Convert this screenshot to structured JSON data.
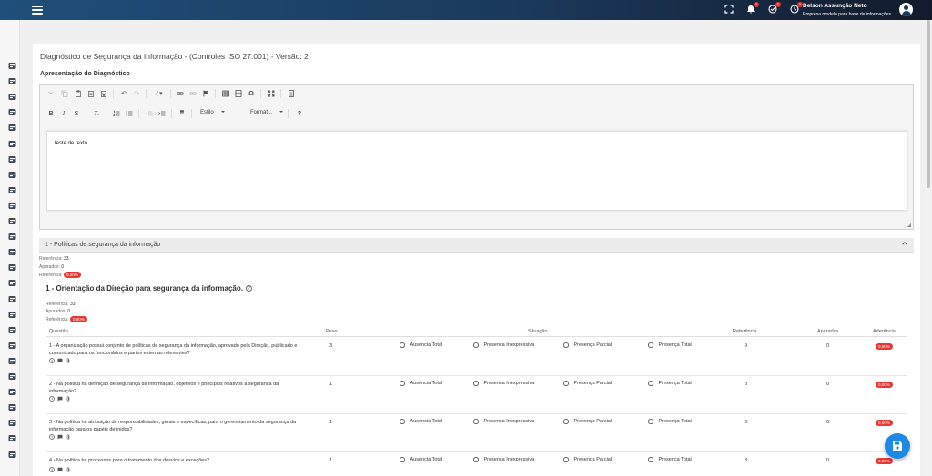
{
  "header": {
    "user_name": "Delson Assunção Neto",
    "company": "Empresa modelo para base de informações",
    "notifications": [
      {
        "icon": "fullscreen-icon",
        "count": ""
      },
      {
        "icon": "bell-icon",
        "count": "1"
      },
      {
        "icon": "check-circle-icon",
        "count": "1"
      },
      {
        "icon": "timer-icon",
        "count": "1"
      }
    ]
  },
  "sidebar": {
    "icons": [
      "store-icon",
      "diamond-icon",
      "headset-icon",
      "group-icon",
      "book-icon",
      "store-icon",
      "grid-icon",
      "shield-check-icon",
      "info-icon",
      "mail-icon",
      "bulb-icon",
      "account-icon",
      "dashboard-icon",
      "dashboard-icon",
      "grid-icon",
      "cancel-icon",
      "clipboard-icon",
      "shield-icon",
      "shield-icon",
      "shield-icon",
      "shield-icon",
      "font-icon",
      "list-icon",
      "forum-icon",
      "forum-icon",
      "link-icon"
    ]
  },
  "page": {
    "title": "Diagnóstico de Segurança da Informação - (Controles ISO 27.001) - Versão: 2",
    "section_label": "Apresentação do Diagnóstico"
  },
  "editor": {
    "style_combo": "Estilo",
    "format_combo": "Format...",
    "content": "teste de texto"
  },
  "accordion": {
    "title": "1 - Políticas de segurança da informação",
    "referencia_label": "Referência:",
    "referencia": "33",
    "apurados_label": "Apurados:",
    "apurados": "0",
    "aderencia_label": "Referência:",
    "aderencia": "0,00%"
  },
  "group": {
    "title": "1 - Orientação da Direção para segurança da informação.",
    "help": "?",
    "referencia_label": "Referência:",
    "referencia": "33",
    "apurados_label": "Apurados:",
    "apurados": "0",
    "aderencia_label": "Referência:",
    "aderencia": "0,00%"
  },
  "table": {
    "headers": {
      "questao": "Questão",
      "peso": "Peso",
      "situacao": "Situação",
      "referencia": "Referência",
      "apurados": "Apurados",
      "aderencia": "Aderência"
    },
    "options": [
      "Ausência Total",
      "Presença Inexpressiva",
      "Presença Parcial",
      "Presença Total"
    ],
    "rows": [
      {
        "text": "1 - A organização possui conjunto de políticas de segurança da informação, aprovado pela Direção, publicado e comunicado para os funcionários e partes externas relevantes?",
        "peso": "3",
        "referencia": "9",
        "apurados": "0",
        "aderencia": "0,00%"
      },
      {
        "text": "2 - Na política há definição de segurança da informação, objetivos e princípios relativos à segurança da informação?",
        "peso": "1",
        "referencia": "3",
        "apurados": "0",
        "aderencia": "0,00%"
      },
      {
        "text": "3 - Na política há atribuição de responsabilidades, gerais e específicas, para o gerenciamento da segurança da informação para os papéis definidos?",
        "peso": "1",
        "referencia": "3",
        "apurados": "0",
        "aderencia": "0,00%"
      },
      {
        "text": "4 - Na política há processos para o tratamento dos desvios e exceções?",
        "peso": "1",
        "referencia": "3",
        "apurados": "0",
        "aderencia": "0,00%"
      }
    ]
  },
  "colors": {
    "topbar_start": "#1f4f7a",
    "topbar_end": "#121b2b",
    "badge": "#e53935",
    "fab": "#1e88e5"
  }
}
